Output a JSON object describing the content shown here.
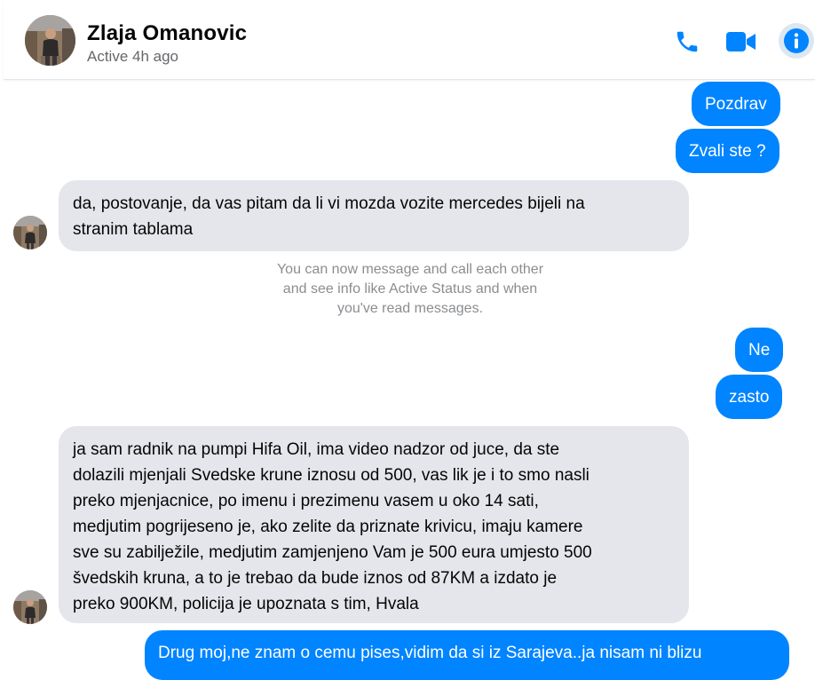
{
  "header": {
    "contact_name": "Zlaja Omanovic",
    "status": "Active 4h ago",
    "actions": {
      "call_icon": "phone-icon",
      "video_icon": "video-camera-icon",
      "info_icon": "info-icon"
    }
  },
  "messages": {
    "m1": {
      "direction": "outgoing",
      "text": "Pozdrav"
    },
    "m2": {
      "direction": "outgoing",
      "text": "Zvali ste ?"
    },
    "m3": {
      "direction": "incoming",
      "lines": [
        "da, postovanje, da vas pitam da li vi mozda vozite mercedes bijeli na",
        "stranim tablama"
      ]
    },
    "system": {
      "lines": [
        "You can now message and call each other",
        "and see info like Active Status and when",
        "you've read messages."
      ]
    },
    "m4": {
      "direction": "outgoing",
      "text": "Ne"
    },
    "m5": {
      "direction": "outgoing",
      "text": "zasto"
    },
    "m6": {
      "direction": "incoming",
      "lines": [
        "ja sam radnik na pumpi Hifa Oil, ima video nadzor od juce, da ste",
        "dolazili mjenjali Svedske krune iznosu od 500, vas lik je i to smo nasli",
        "preko mjenjacnice, po imenu i prezimenu vasem u oko 14 sati,",
        "medjutim pogrijeseno je, ako zelite da priznate krivicu, imaju kamere",
        "sve su zabilježile, medjutim zamjenjeno Vam je 500 eura umjesto 500",
        "švedskih kruna, a to je trebao da bude iznos od 87KM a izdato je",
        "preko 900KM, policija je upoznata s tim, Hvala"
      ]
    },
    "m7": {
      "direction": "outgoing",
      "text": "Drug moj,ne znam o cemu pises,vidim da si iz Sarajeva..ja nisam ni blizu"
    }
  },
  "colors": {
    "accent": "#0084ff",
    "incoming_bubble": "#e4e6eb",
    "outgoing_bubble": "#0084ff",
    "info_button_bg": "#dbe7f2",
    "secondary_text": "#65676b"
  }
}
